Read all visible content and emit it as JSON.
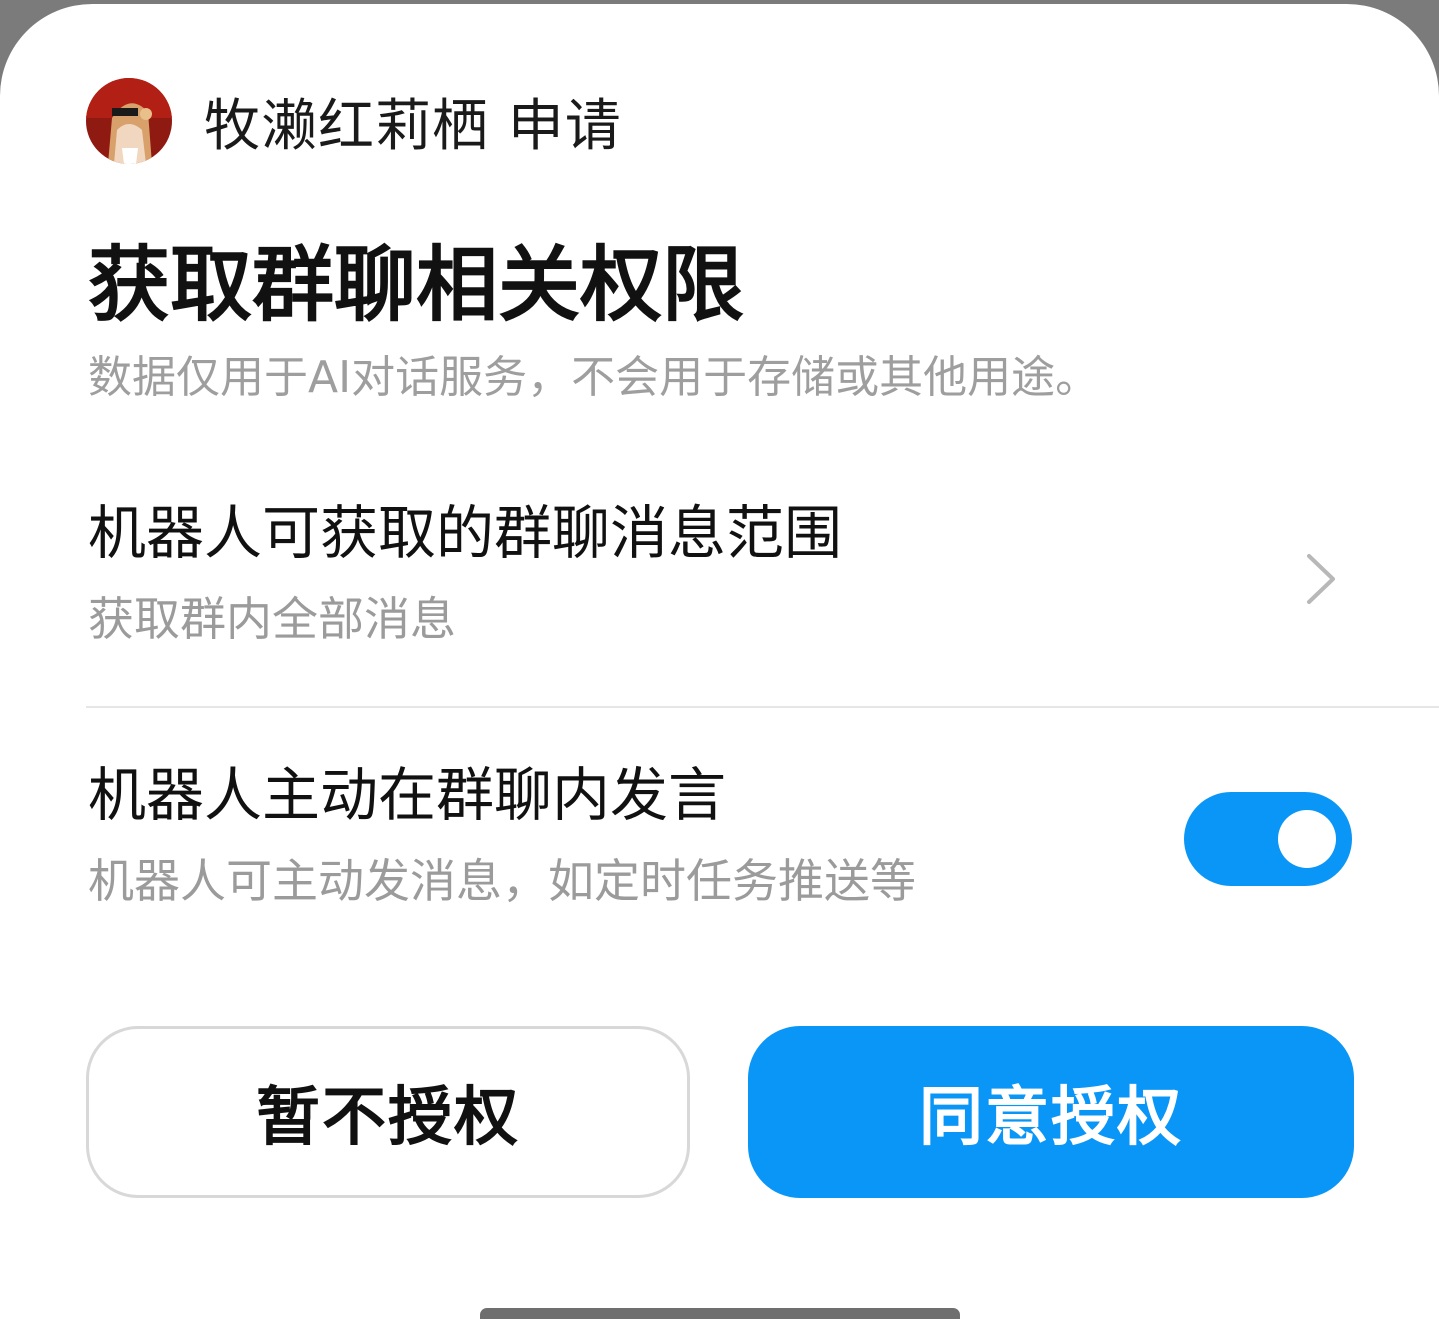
{
  "requester": {
    "avatar_icon": "anime-character-avatar",
    "text": "牧濑红莉栖 申请"
  },
  "dialog": {
    "title": "获取群聊相关权限",
    "subtitle": "数据仅用于AI对话服务，不会用于存储或其他用途。"
  },
  "permissions": [
    {
      "title": "机器人可获取的群聊消息范围",
      "value": "获取群内全部消息",
      "icon": "chevron-right-icon"
    },
    {
      "title": "机器人主动在群聊内发言",
      "description": "机器人可主动发消息，如定时任务推送等",
      "toggle_on": true
    }
  ],
  "buttons": {
    "decline_label": "暂不授权",
    "accept_label": "同意授权"
  },
  "colors": {
    "accent": "#0a96f7",
    "secondary_text": "#9b9b9b",
    "primary_text": "#111111"
  }
}
